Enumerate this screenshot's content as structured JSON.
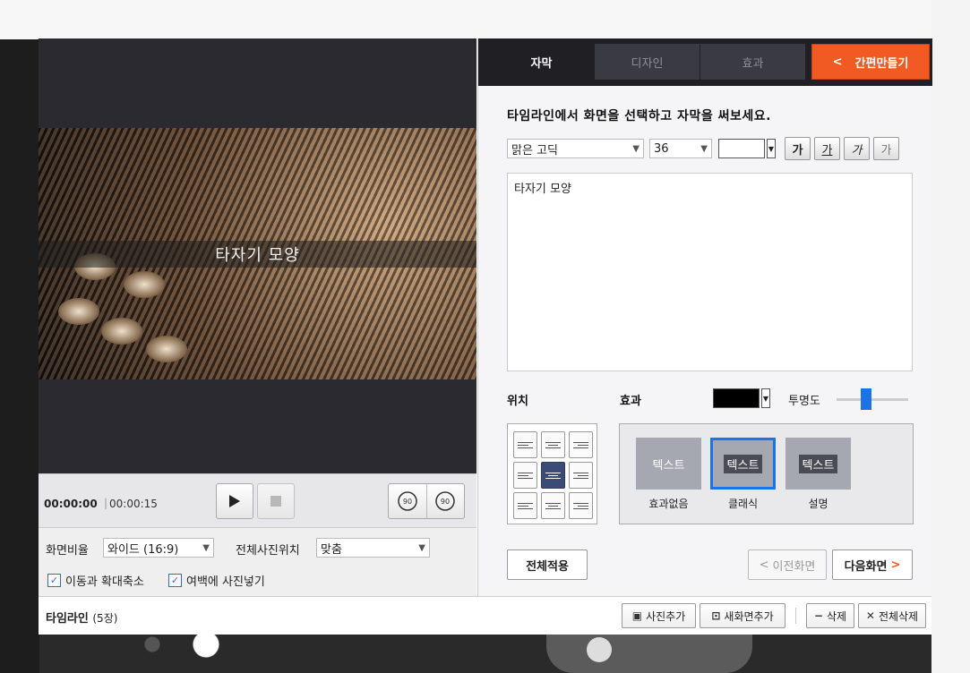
{
  "preview": {
    "subtitle": "타자기 모양",
    "time_current": "00:00:00",
    "time_total": "00:00:15",
    "rotate_left_label": "90",
    "rotate_right_label": "90"
  },
  "settings": {
    "ratio_label": "화면비율",
    "ratio_value": "와이드 (16:9)",
    "photo_pos_label": "전체사진위치",
    "photo_pos_value": "맞춤",
    "check_pan_zoom": "이동과 확대축소",
    "check_fill_margin": "여백에 사진넣기"
  },
  "tabs": {
    "items": [
      {
        "label": "자막",
        "active": true
      },
      {
        "label": "디자인",
        "active": false
      },
      {
        "label": "효과",
        "active": false
      }
    ],
    "quick_label": "간편만들기",
    "quick_color": "#f15a22"
  },
  "caption": {
    "instruction": "타임라인에서 화면을 선택하고 자막을 써보세요.",
    "font_value": "맑은 고딕",
    "size_value": "36",
    "bold": "가",
    "underline": "가",
    "italic": "가",
    "outline": "가",
    "text": "타자기 모양"
  },
  "position": {
    "label": "위치",
    "selected_index": 4
  },
  "effect": {
    "label": "효과",
    "opacity_label": "투명도",
    "opacity_level": 0.4,
    "tag_text": "텍스트",
    "options": [
      {
        "caption": "효과없음",
        "selected": false
      },
      {
        "caption": "클래식",
        "selected": true
      },
      {
        "caption": "설명",
        "selected": false
      }
    ]
  },
  "actions": {
    "apply_all": "전체적용",
    "prev_screen": "이전화면",
    "next_screen": "다음화면"
  },
  "timeline": {
    "label": "타임라인",
    "count": "(5장)",
    "add_photo": "사진추가",
    "add_screen": "새화면추가",
    "delete": "삭제",
    "delete_all": "전체삭제"
  }
}
